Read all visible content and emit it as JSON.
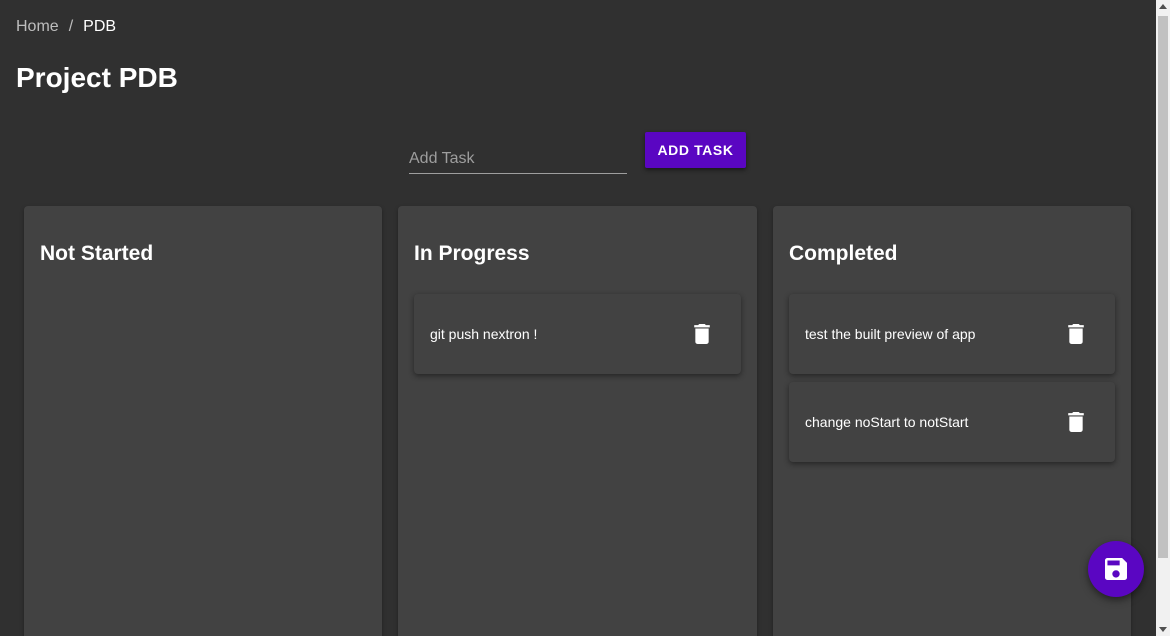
{
  "breadcrumb": {
    "home": "Home",
    "separator": "/",
    "current": "PDB"
  },
  "page": {
    "title": "Project PDB"
  },
  "add_task": {
    "placeholder": "Add Task",
    "value": "",
    "button_label": "ADD TASK"
  },
  "columns": [
    {
      "title": "Not Started",
      "tasks": []
    },
    {
      "title": "In Progress",
      "tasks": [
        {
          "text": "git push nextron !"
        }
      ]
    },
    {
      "title": "Completed",
      "tasks": [
        {
          "text": "test the built preview of app"
        },
        {
          "text": "change noStart to notStart"
        }
      ]
    }
  ],
  "fab": {
    "icon": "save-icon"
  },
  "colors": {
    "background": "#303030",
    "panel": "#424242",
    "accent": "#5a06c2"
  }
}
